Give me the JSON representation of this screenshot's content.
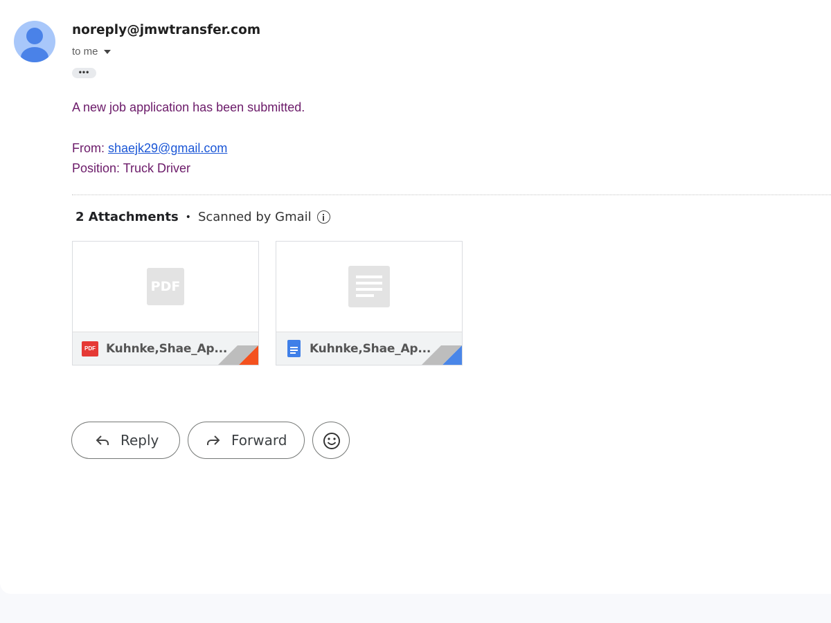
{
  "sender": {
    "email": "noreply@jmwtransfer.com",
    "recipient_label": "to me",
    "ellipsis": "•••"
  },
  "body": {
    "line1": "A new job application has been submitted.",
    "from_label": "From: ",
    "from_email": "shaejk29@gmail.com",
    "position_line": "Position: Truck Driver"
  },
  "attachments": {
    "count_label": "2 Attachments",
    "separator": "•",
    "scanned_label": "Scanned by Gmail",
    "items": [
      {
        "name": "Kuhnke,Shae_Ap...",
        "type": "pdf",
        "thumb_label": "PDF",
        "icon_label": "PDF",
        "accent": "#f4511e"
      },
      {
        "name": "Kuhnke,Shae_Ap...",
        "type": "doc",
        "accent": "#4a86e8"
      }
    ]
  },
  "actions": {
    "reply_label": "Reply",
    "forward_label": "Forward"
  },
  "icons": {
    "avatar": "person-avatar-icon",
    "caret": "chevron-down-icon",
    "info": "info-icon",
    "reply": "reply-arrow-icon",
    "forward": "forward-arrow-icon",
    "emoji": "smiley-face-icon"
  },
  "colors": {
    "body_text": "#6b1a69",
    "link": "#1a56d6",
    "avatar_bg": "#a8c7fa",
    "avatar_fg": "#4a82e8",
    "pdf_red": "#e53935",
    "doc_blue": "#3f7fe8"
  }
}
